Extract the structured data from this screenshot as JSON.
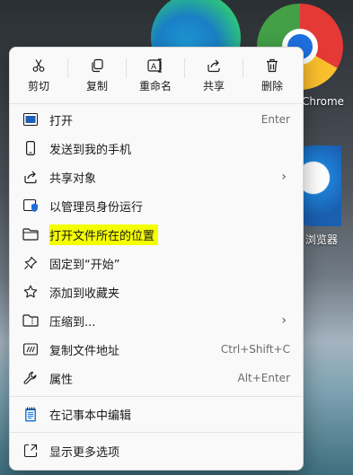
{
  "desktop": {
    "chrome_label": "Chrome",
    "browser_label": "浏览器"
  },
  "toolbar": {
    "cut": "剪切",
    "copy": "复制",
    "rename": "重命名",
    "share": "共享",
    "delete": "删除"
  },
  "menu": {
    "open": {
      "label": "打开",
      "shortcut": "Enter"
    },
    "send_to_phone": {
      "label": "发送到我的手机"
    },
    "share_object": {
      "label": "共享对象"
    },
    "run_as_admin": {
      "label": "以管理员身份运行"
    },
    "open_file_location": {
      "label": "打开文件所在的位置"
    },
    "pin_to_start": {
      "label": "固定到“开始”"
    },
    "add_to_favorites": {
      "label": "添加到收藏夹"
    },
    "compress_to": {
      "label": "压缩到..."
    },
    "copy_path": {
      "label": "复制文件地址",
      "shortcut": "Ctrl+Shift+C"
    },
    "properties": {
      "label": "属性",
      "shortcut": "Alt+Enter"
    },
    "edit_in_notepad": {
      "label": "在记事本中编辑"
    },
    "show_more_options": {
      "label": "显示更多选项"
    }
  },
  "colors": {
    "highlight": "#f4ff00",
    "accent": "#0067c0"
  }
}
